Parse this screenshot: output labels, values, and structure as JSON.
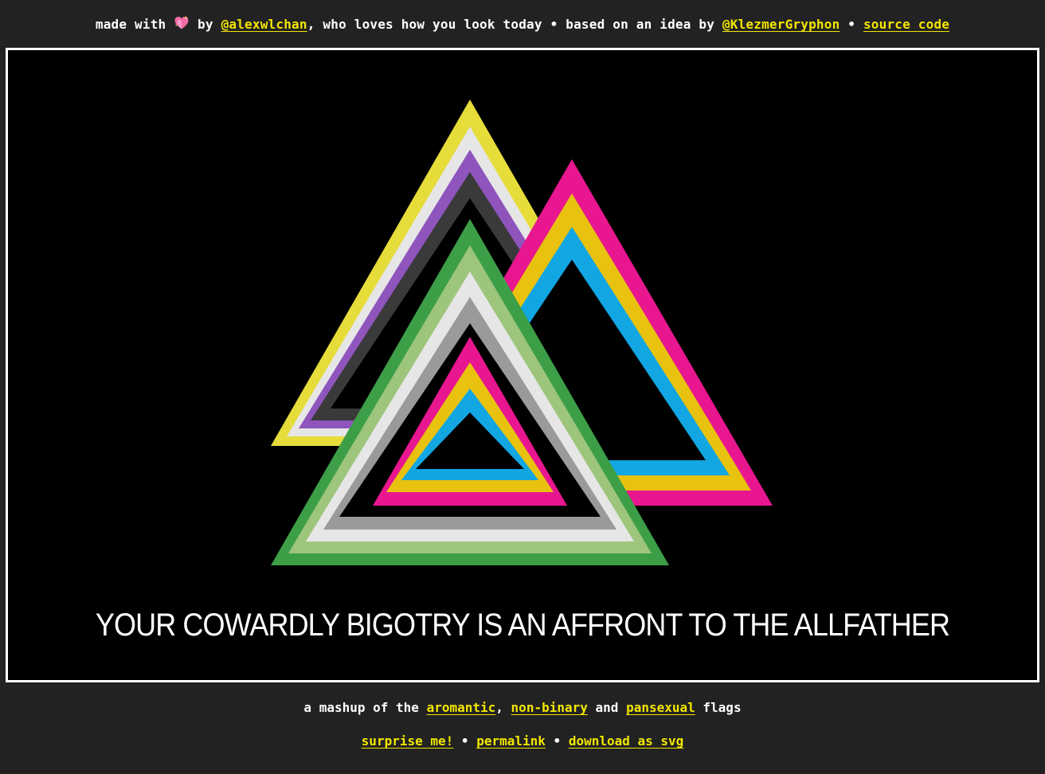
{
  "credits": {
    "made_with": "made with",
    "heart_icon": "sparkling-heart",
    "by": "by",
    "author_link": "@alexwlchan",
    "who_loves": ", who loves how you look today",
    "separator": "•",
    "based_on": "based on an idea by",
    "idea_link": "@KlezmerGryphon",
    "source_link": "source code"
  },
  "flag": {
    "tagline": "YOUR COWARDLY BIGOTRY IS AN AFFRONT TO THE ALLFATHER",
    "background": "#000000",
    "border": "#ffffff",
    "triangles": [
      {
        "name": "non-binary",
        "stripes": [
          "#e6dc3a",
          "#e6e6e6",
          "#8f55bd",
          "#3a3a3a"
        ]
      },
      {
        "name": "pansexual",
        "stripes": [
          "#e8168f",
          "#e8c20f",
          "#12a6e3"
        ]
      },
      {
        "name": "aromantic",
        "stripes": [
          "#3d9e48",
          "#9dc57c",
          "#e6e6e6",
          "#9a9a9a"
        ]
      }
    ]
  },
  "mashup": {
    "prefix": "a mashup of the",
    "flag1": "aromantic",
    "comma": ",",
    "flag2": "non-binary",
    "and": "and",
    "flag3": "pansexual",
    "suffix": "flags"
  },
  "actions": {
    "surprise": "surprise me!",
    "permalink": "permalink",
    "download": "download as svg",
    "separator": "•"
  },
  "colors": {
    "link": "#f2e600",
    "page_bg": "#222222",
    "text": "#ffffff"
  }
}
